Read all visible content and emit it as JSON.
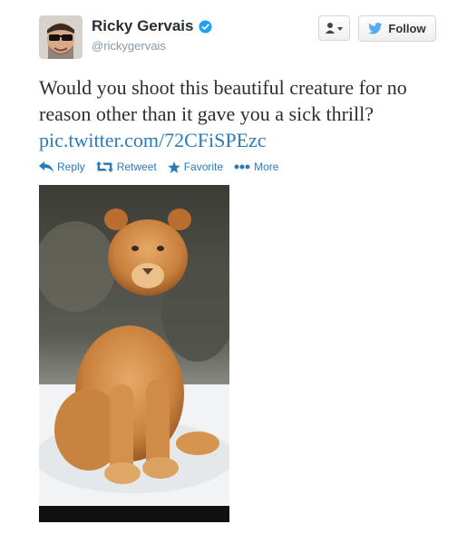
{
  "user": {
    "full_name": "Ricky Gervais",
    "handle": "@rickygervais",
    "verified": true
  },
  "header": {
    "follow_label": "Follow",
    "user_actions_icon": "user-dropdown-icon"
  },
  "tweet": {
    "text": "Would you shoot this beautiful creature for no reason other than it gave you a sick thrill?",
    "link": "pic.twitter.com/72CFiSPEzc"
  },
  "actions": [
    {
      "label": "Reply",
      "icon": "reply-icon"
    },
    {
      "label": "Retweet",
      "icon": "retweet-icon"
    },
    {
      "label": "Favorite",
      "icon": "star-icon"
    },
    {
      "label": "More",
      "icon": "more-icon"
    }
  ],
  "colors": {
    "link": "#2b7bb9",
    "verified": "#1da1f2",
    "twitter_bird": "#55acee"
  }
}
